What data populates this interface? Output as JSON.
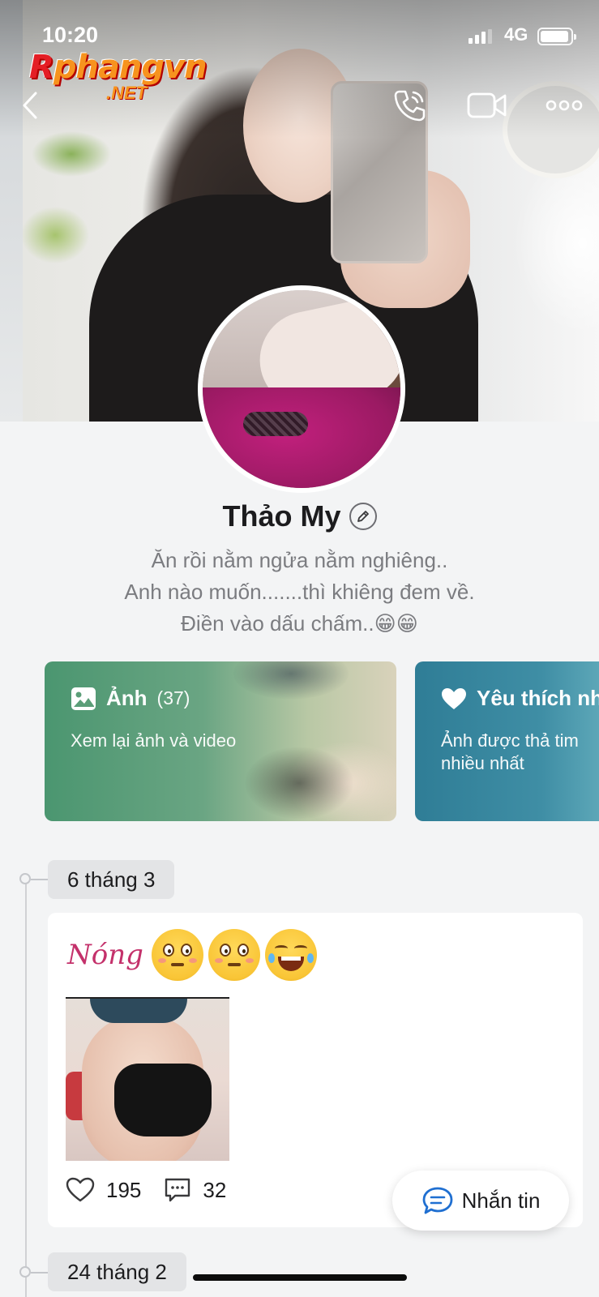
{
  "status_bar": {
    "time": "10:20",
    "network": "4G",
    "signal_bars": 3,
    "battery_level": 0.8
  },
  "watermark": {
    "main_lead": "R",
    "main_rest": "phangvn",
    "sub": ".NET"
  },
  "header": {
    "back_icon": "chevron-left-icon",
    "call_icon": "phone-icon",
    "video_icon": "video-camera-icon",
    "more_icon": "more-dots-icon"
  },
  "profile": {
    "name": "Thảo My",
    "edit_icon": "pencil-icon",
    "bio_lines": [
      "Ăn rồi nằm ngửa nằm nghiêng..",
      "Anh nào muốn.......thì khiêng đem về.",
      "Điền vào dấu chấm..😁😁"
    ]
  },
  "cards": {
    "photos": {
      "icon": "image-icon",
      "title": "Ảnh",
      "count": "(37)",
      "subtitle": "Xem lại ảnh và video"
    },
    "favorites": {
      "icon": "heart-icon",
      "title": "Yêu thích nh",
      "subtitle": "Ảnh được thả tim nhiều nhất"
    }
  },
  "timeline": {
    "groups": [
      {
        "date": "6 tháng 3",
        "post": {
          "text": "Nóng",
          "emojis": [
            "flushed-face",
            "flushed-face",
            "face-with-tears-of-joy"
          ],
          "likes": "195",
          "comments": "32",
          "like_icon": "heart-outline-icon",
          "comment_icon": "comment-icon"
        }
      },
      {
        "date": "24 tháng 2"
      }
    ]
  },
  "message_button": {
    "label": "Nhắn tin",
    "icon": "chat-bubble-icon",
    "accent": "#1f6fd1"
  }
}
